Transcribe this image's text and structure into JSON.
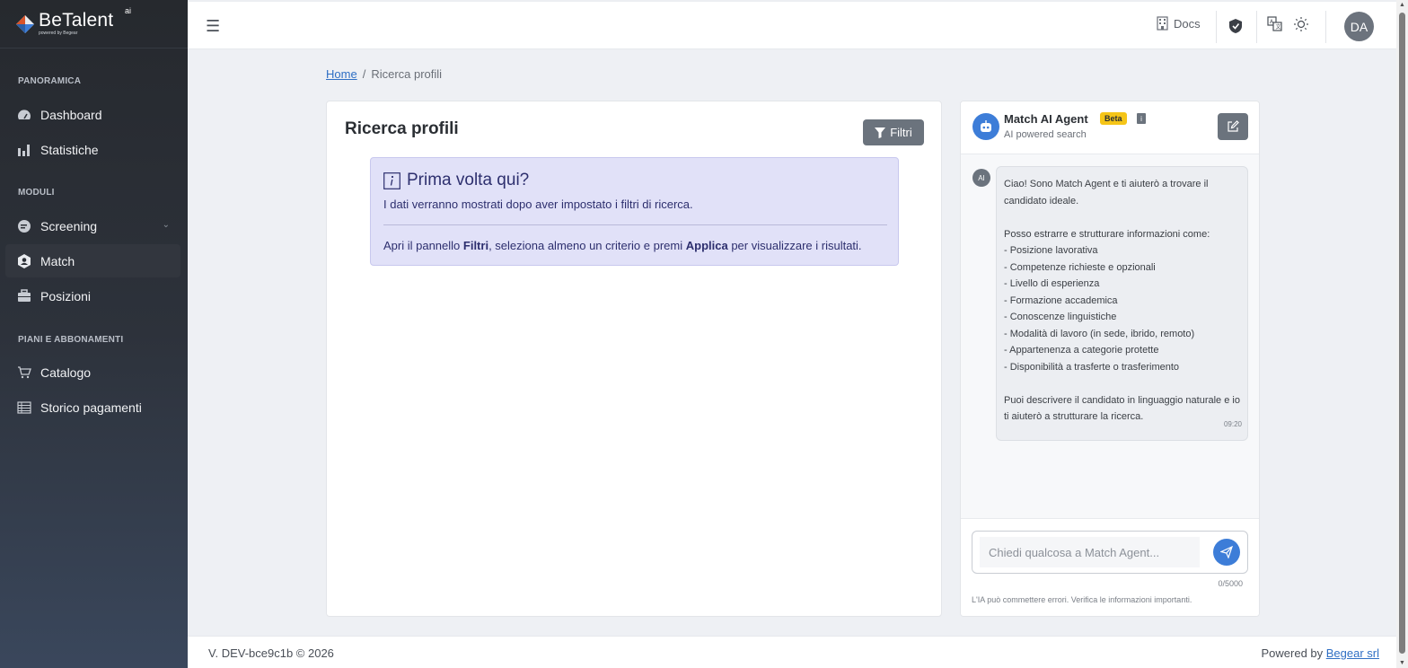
{
  "brand": {
    "name": "BeTalent",
    "sup": "ai",
    "tagline": "powered by Begear"
  },
  "sidebar": {
    "sections": [
      {
        "title": "PANORAMICA"
      },
      {
        "title": "MODULI"
      },
      {
        "title": "PIANI E ABBONAMENTI"
      }
    ],
    "items": [
      {
        "label": "Dashboard",
        "icon": "gauge-icon"
      },
      {
        "label": "Statistiche",
        "icon": "bar-chart-icon"
      },
      {
        "label": "Screening",
        "icon": "screening-icon"
      },
      {
        "label": "Match",
        "icon": "match-icon",
        "active": true
      },
      {
        "label": "Posizioni",
        "icon": "briefcase-icon"
      },
      {
        "label": "Catalogo",
        "icon": "cart-icon"
      },
      {
        "label": "Storico pagamenti",
        "icon": "ledger-icon"
      }
    ]
  },
  "topbar": {
    "docs_label": "Docs",
    "avatar_initials": "DA"
  },
  "breadcrumb": {
    "home": "Home",
    "separator": "/",
    "current": "Ricerca profili"
  },
  "main": {
    "title": "Ricerca profili",
    "filter_button": "Filtri",
    "info": {
      "heading": "Prima volta qui?",
      "line1": "I dati verranno mostrati dopo aver impostato i filtri di ricerca.",
      "line2_a": "Apri il pannello ",
      "line2_b": "Filtri",
      "line2_c": ", seleziona almeno un criterio e premi ",
      "line2_d": "Applica",
      "line2_e": " per visualizzare i risultati."
    }
  },
  "chat": {
    "agent_name": "Match AI Agent",
    "badge": "Beta",
    "info_glyph": "i",
    "subtitle": "AI powered search",
    "ai_avatar": "AI",
    "message": {
      "intro": "Ciao! Sono Match Agent e ti aiuterò a trovare il candidato ideale.",
      "list_intro": "Posso estrarre e strutturare informazioni come:",
      "items": [
        "- Posizione lavorativa",
        "- Competenze richieste e opzionali",
        "- Livello di esperienza",
        "- Formazione accademica",
        "- Conoscenze linguistiche",
        "- Modalità di lavoro (in sede, ibrido, remoto)",
        "- Appartenenza a categorie protette",
        "- Disponibilità a trasferte o trasferimento"
      ],
      "outro": "Puoi descrivere il candidato in linguaggio naturale e io ti aiuterò a strutturare la ricerca.",
      "time": "09:20"
    },
    "input_placeholder": "Chiedi qualcosa a Match Agent...",
    "char_count": "0/5000",
    "disclaimer": "L'IA può commettere errori. Verifica le informazioni importanti."
  },
  "footer": {
    "version": "V. DEV-bce9c1b © 2026",
    "powered_prefix": "Powered by ",
    "powered_link": "Begear srl"
  },
  "colors": {
    "accent": "#3d7dd8",
    "info_bg": "#e1e1f8",
    "beta": "#f5c518",
    "sidebar_top": "#26292e",
    "sidebar_bottom": "#3a475c"
  }
}
